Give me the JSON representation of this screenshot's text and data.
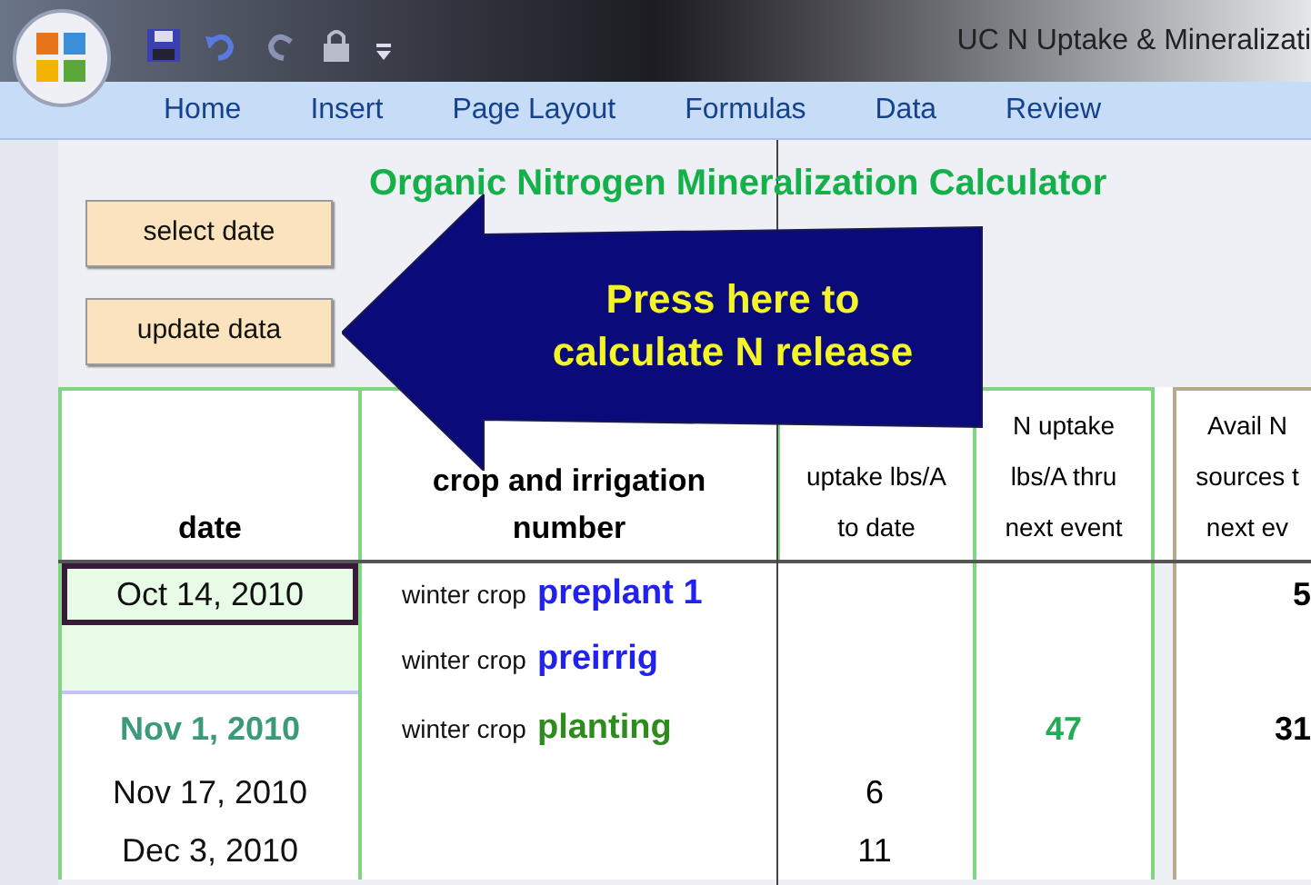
{
  "window": {
    "title": "UC N Uptake & Mineralizati"
  },
  "ribbon_tabs": [
    {
      "label": "Home",
      "selected": false
    },
    {
      "label": "Insert",
      "selected": false
    },
    {
      "label": "Page Layout",
      "selected": false
    },
    {
      "label": "Formulas",
      "selected": false
    },
    {
      "label": "Data",
      "selected": false
    },
    {
      "label": "Review",
      "selected": false
    }
  ],
  "sheet": {
    "title": "Organic Nitrogen Mineralization Calculator",
    "buttons": [
      "select date",
      "update data"
    ],
    "callout": [
      "Press here to",
      "calculate N release"
    ],
    "columns": [
      {
        "lines": [
          "date"
        ]
      },
      {
        "lines": [
          "crop and irrigation",
          "number"
        ]
      },
      {
        "lines": [
          "uptake lbs/A",
          "to date"
        ]
      },
      {
        "lines": [
          "N uptake",
          "lbs/A thru",
          "next event"
        ]
      },
      {
        "lines": [
          "Avail N",
          "sources t",
          "next ev"
        ]
      }
    ],
    "rows": [
      {
        "date": "Oct 14, 2010",
        "selected": true,
        "shaded": true,
        "milestone": false,
        "crop": "winter crop",
        "event": "preplant 1",
        "color": "#2222ee",
        "avail": "5"
      },
      {
        "selected": false,
        "shaded": true,
        "crop": "winter crop",
        "event": "preirrig",
        "color": "#2222ee"
      },
      {
        "date": "Nov 1, 2010",
        "selected": false,
        "shaded": false,
        "milestone": true,
        "crop": "winter crop",
        "event": "planting",
        "color": "#2e8b1e",
        "next": "47",
        "avail": "31"
      },
      {
        "date": "Nov 17, 2010",
        "selected": false,
        "shaded": false,
        "milestone": false,
        "cumulative": "6"
      },
      {
        "date": "Dec 3, 2010",
        "selected": false,
        "shaded": false,
        "milestone": false,
        "cumulative": "11"
      }
    ]
  }
}
